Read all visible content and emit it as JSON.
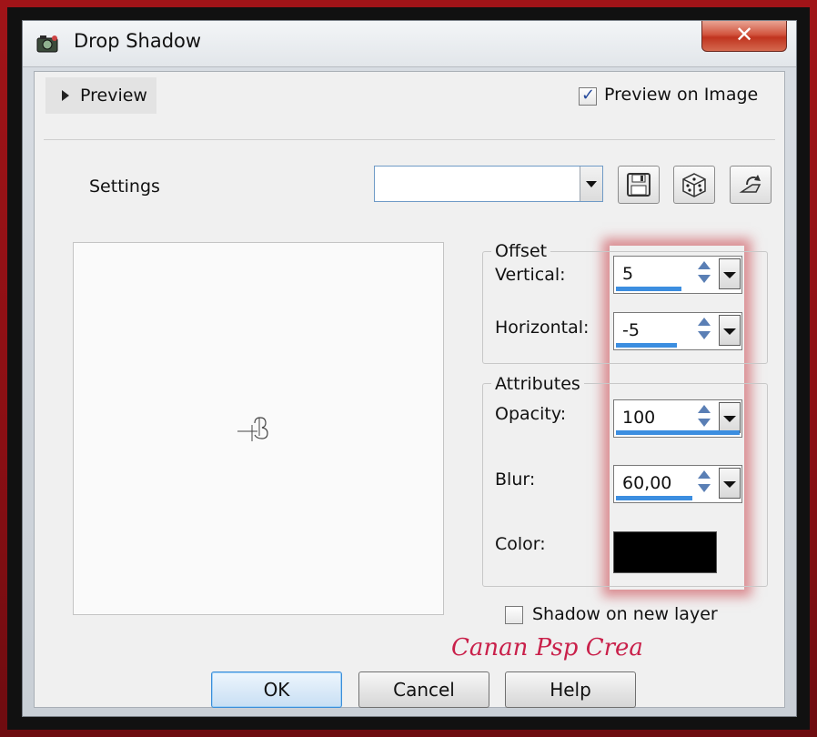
{
  "window": {
    "title": "Drop Shadow",
    "close_label": "✕"
  },
  "header": {
    "preview_toggle_label": "Preview",
    "preview_on_image_label": "Preview on Image",
    "preview_on_image_checked": true
  },
  "settings": {
    "label": "Settings",
    "combo_value": "",
    "buttons": [
      "save-preset-icon",
      "randomize-dice-icon",
      "reset-icon"
    ]
  },
  "offset": {
    "group_title": "Offset",
    "vertical": {
      "label": "Vertical:",
      "value": "5",
      "level_fraction": 0.53
    },
    "horizontal": {
      "label": "Horizontal:",
      "value": "-5",
      "level_fraction": 0.49
    }
  },
  "attributes": {
    "group_title": "Attributes",
    "opacity": {
      "label": "Opacity:",
      "value": "100",
      "level_fraction": 1.0
    },
    "blur": {
      "label": "Blur:",
      "value": "60,00",
      "level_fraction": 0.62
    },
    "color": {
      "label": "Color:",
      "value": "#000000"
    }
  },
  "shadow_on_new_layer": {
    "label": "Shadow on new layer",
    "checked": false
  },
  "watermark": "Canan Psp Crea",
  "buttons": {
    "ok": "OK",
    "cancel": "Cancel",
    "help": "Help"
  },
  "colors": {
    "accent": "#3c8ee0",
    "frame": "#8a0f14",
    "watermark": "#c9204a"
  }
}
